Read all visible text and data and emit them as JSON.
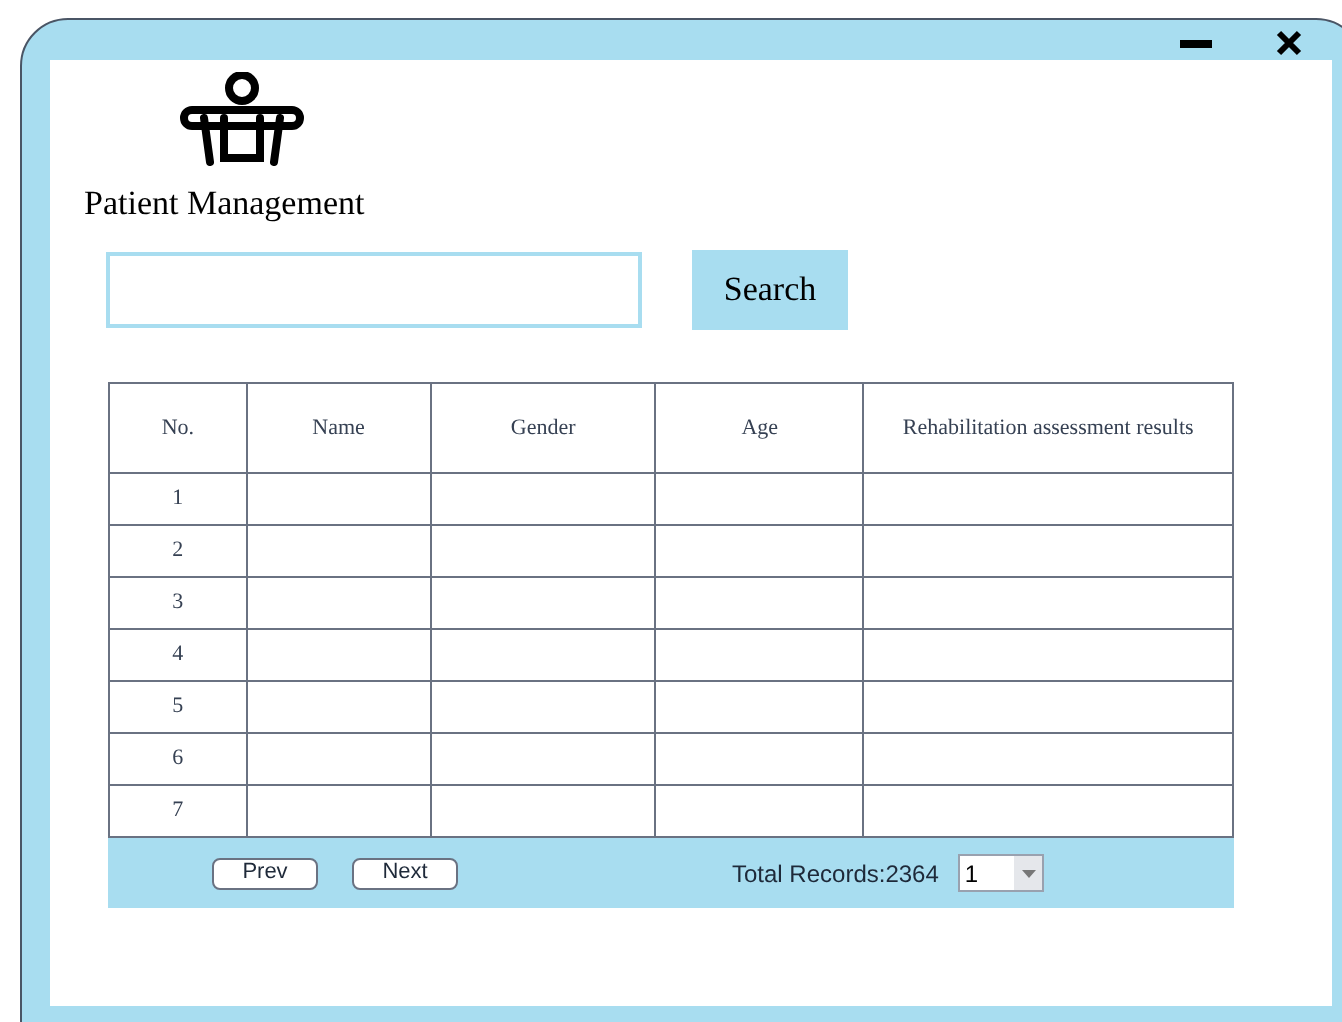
{
  "app": {
    "title": "Patient Management"
  },
  "search": {
    "button": "Search"
  },
  "table": {
    "columns": [
      "No.",
      "Name",
      "Gender",
      "Age",
      "Rehabilitation assessment results"
    ],
    "rows": [
      [
        "1"
      ],
      [
        "2"
      ],
      [
        "3"
      ],
      [
        "4"
      ],
      [
        "5"
      ],
      [
        "6"
      ],
      [
        "7"
      ]
    ]
  },
  "pagination": {
    "prev": "Prev",
    "next": "Next",
    "total": "Total Records:2364",
    "page": "1"
  }
}
